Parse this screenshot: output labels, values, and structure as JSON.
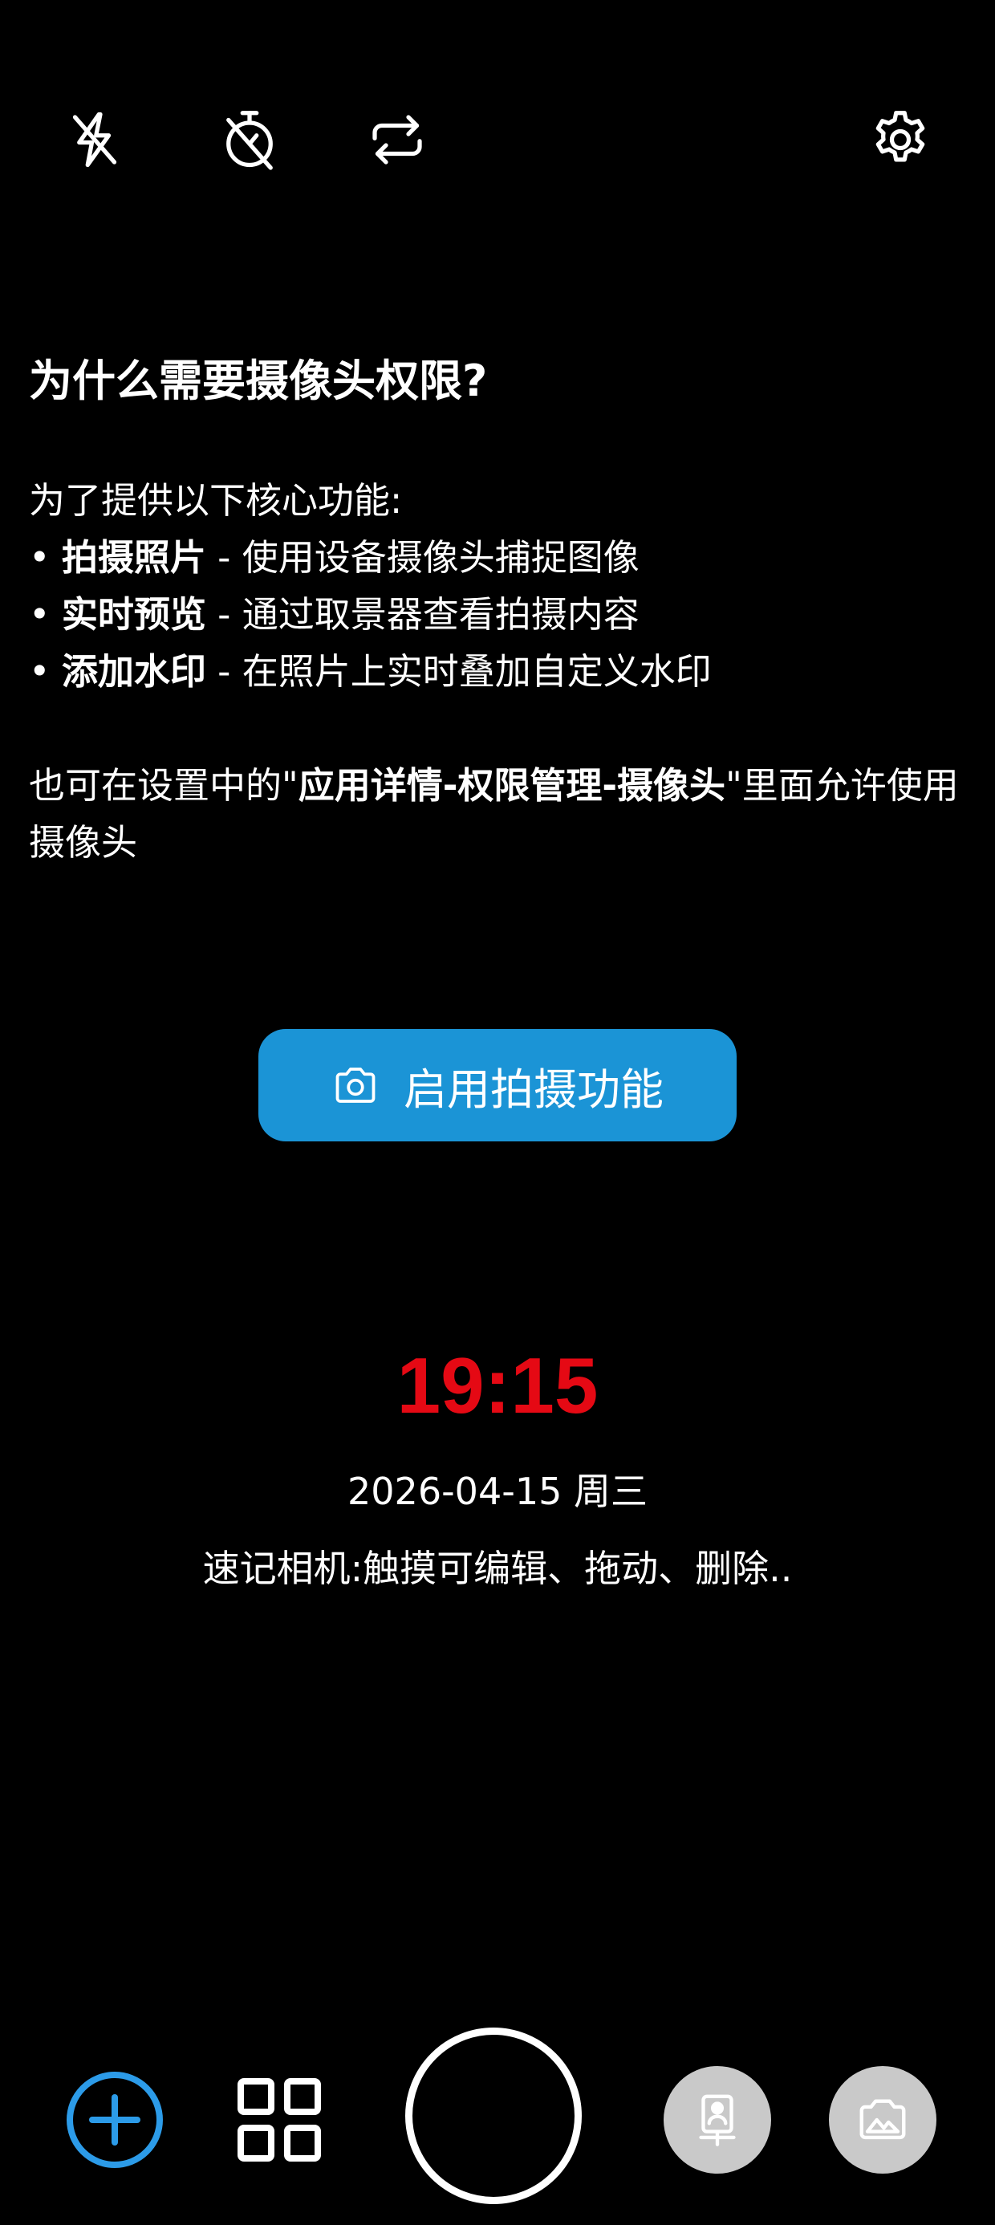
{
  "toolbar": {
    "icons": [
      "flash-off-icon",
      "timer-off-icon",
      "switch-camera-icon",
      "gear-icon"
    ]
  },
  "permission": {
    "title": "为什么需要摄像头权限?",
    "intro": "为了提供以下核心功能:",
    "features": [
      {
        "bullet": "• ",
        "name": "拍摄照片",
        "desc": " - 使用设备摄像头捕捉图像"
      },
      {
        "bullet": "• ",
        "name": "实时预览",
        "desc": " - 通过取景器查看拍摄内容"
      },
      {
        "bullet": "• ",
        "name": "添加水印",
        "desc": " - 在照片上实时叠加自定义水印"
      }
    ],
    "note_prefix": "也可在设置中的\"",
    "note_bold": "应用详情-权限管理-摄像头",
    "note_suffix": "\"里面允许使用摄像头"
  },
  "enable_button": {
    "label": "启用拍摄功能",
    "icon": "camera-icon",
    "color": "#1b94d6"
  },
  "watermark": {
    "time": "19:15",
    "time_color": "#e50914",
    "date": "2026-04-15 周三",
    "note": "速记相机:触摸可编辑、拖动、删除.."
  },
  "bottom_bar": {
    "icons": [
      "add-circle-icon",
      "grid-icon",
      "shutter-button",
      "portrait-mode-icon",
      "gallery-icon"
    ],
    "accent": "#2c9be8"
  }
}
